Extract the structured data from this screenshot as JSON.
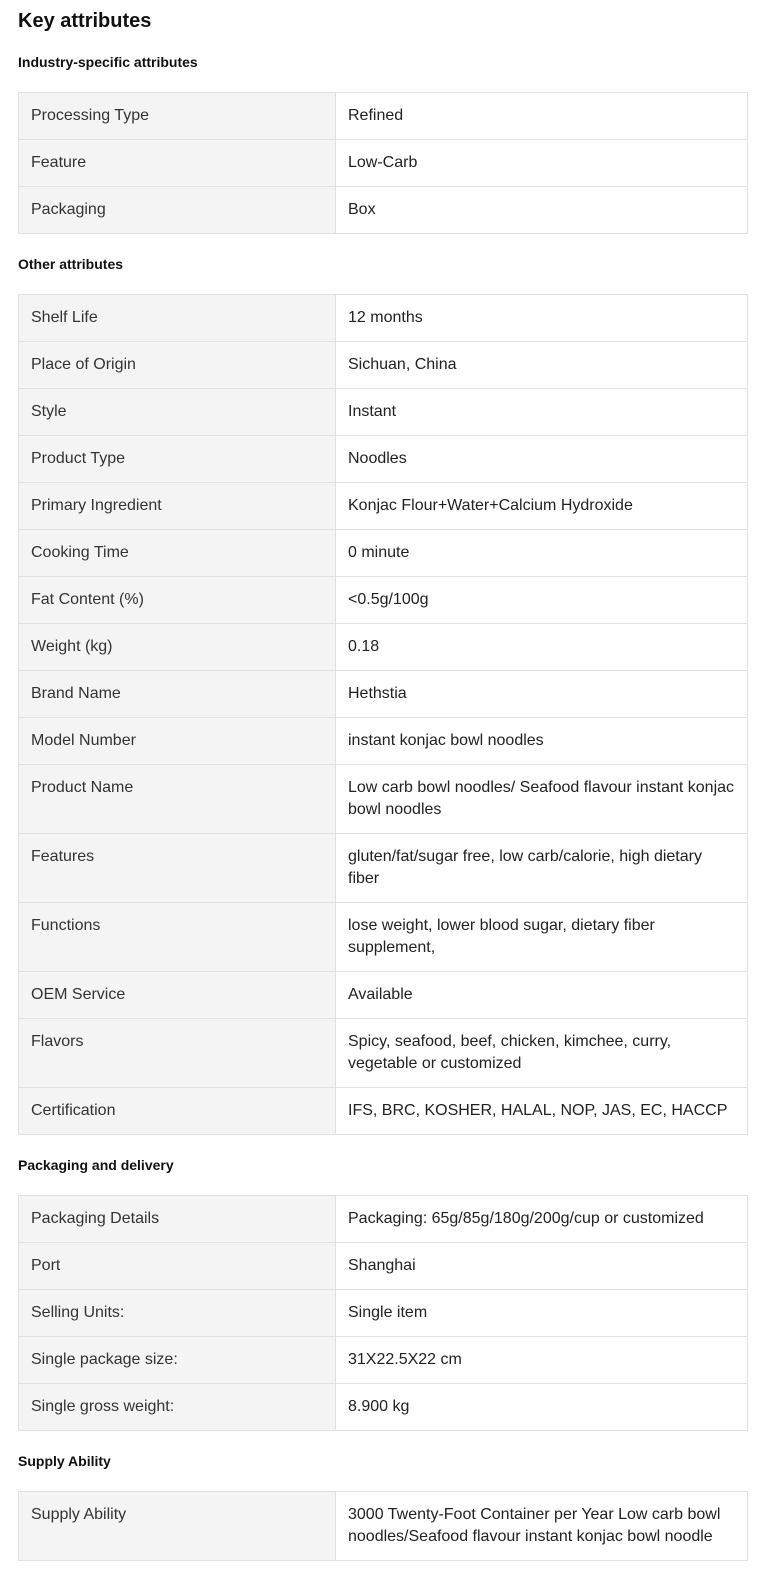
{
  "title": "Key attributes",
  "sections": [
    {
      "heading": "Industry-specific attributes",
      "rows": [
        {
          "key": "Processing Type",
          "value": "Refined"
        },
        {
          "key": "Feature",
          "value": "Low-Carb"
        },
        {
          "key": "Packaging",
          "value": "Box"
        }
      ]
    },
    {
      "heading": "Other attributes",
      "rows": [
        {
          "key": "Shelf Life",
          "value": "12 months"
        },
        {
          "key": "Place of Origin",
          "value": "Sichuan, China"
        },
        {
          "key": "Style",
          "value": "Instant"
        },
        {
          "key": "Product Type",
          "value": "Noodles"
        },
        {
          "key": "Primary Ingredient",
          "value": "Konjac Flour+Water+Calcium Hydroxide"
        },
        {
          "key": "Cooking Time",
          "value": "0 minute"
        },
        {
          "key": "Fat Content (%)",
          "value": "<0.5g/100g"
        },
        {
          "key": "Weight (kg)",
          "value": "0.18"
        },
        {
          "key": "Brand Name",
          "value": "Hethstia"
        },
        {
          "key": "Model Number",
          "value": "instant konjac bowl noodles"
        },
        {
          "key": "Product Name",
          "value": "Low carb bowl noodles/ Seafood flavour instant konjac bowl noodles"
        },
        {
          "key": "Features",
          "value": "gluten/fat/sugar free, low carb/calorie, high dietary fiber"
        },
        {
          "key": "Functions",
          "value": "lose weight, lower blood sugar, dietary fiber supplement,"
        },
        {
          "key": "OEM Service",
          "value": "Available"
        },
        {
          "key": "Flavors",
          "value": "Spicy, seafood, beef, chicken, kimchee, curry, vegetable or customized"
        },
        {
          "key": "Certification",
          "value": "IFS, BRC, KOSHER, HALAL, NOP, JAS, EC, HACCP"
        }
      ]
    },
    {
      "heading": "Packaging and delivery",
      "rows": [
        {
          "key": "Packaging Details",
          "value": "Packaging: 65g/85g/180g/200g/cup or customized"
        },
        {
          "key": "Port",
          "value": "Shanghai"
        },
        {
          "key": "Selling Units:",
          "value": "Single item"
        },
        {
          "key": "Single package size:",
          "value": "31X22.5X22 cm"
        },
        {
          "key": "Single gross weight:",
          "value": "8.900 kg"
        }
      ]
    },
    {
      "heading": "Supply Ability",
      "rows": [
        {
          "key": "Supply Ability",
          "value": "3000 Twenty-Foot Container per Year Low carb bowl noodles/Seafood flavour instant konjac bowl noodle"
        }
      ]
    }
  ],
  "colors": {
    "key_cell_bg": "#f4f4f4",
    "value_cell_bg": "#ffffff",
    "border": "#e1e1e1",
    "text": "#222222"
  }
}
